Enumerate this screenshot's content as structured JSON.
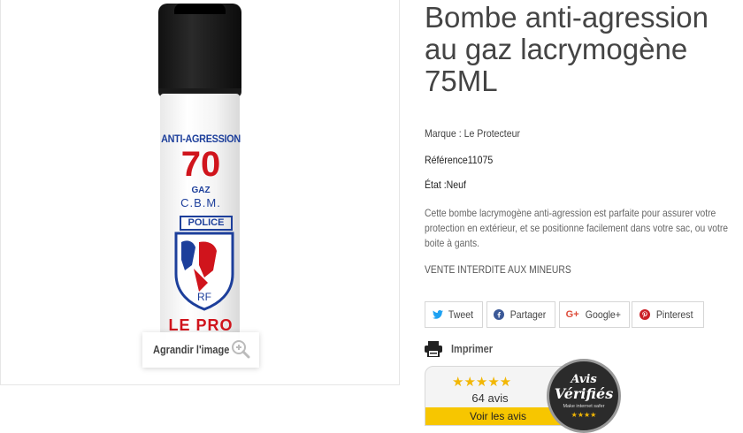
{
  "product": {
    "title": "Bombe anti-agression au gaz lacrymogène 75ML",
    "brand_line": "Marque : Le Protecteur",
    "reference_line": "Référence11075",
    "state_line": "État :Neuf",
    "description": "Cette bombe lacrymogène anti-agression est parfaite pour assurer votre protection en extérieur, et se positionne facilement dans votre sac, ou votre boite à gants.",
    "warning": "VENTE INTERDITE AUX MINEURS"
  },
  "image": {
    "zoom_label": "Agrandir l'image",
    "can_label": {
      "anti": "ANTI-AGRESSION",
      "number": "70",
      "gaz": "GAZ",
      "cbm": "C.B.M.",
      "police": "POLICE",
      "le_pro": "LE PRO"
    }
  },
  "share": {
    "tweet": "Tweet",
    "partager": "Partager",
    "google": "Google+",
    "pinterest": "Pinterest",
    "google_icon": "G+"
  },
  "print": {
    "label": "Imprimer"
  },
  "reviews": {
    "stars": "★★★★★",
    "rating": 5,
    "count_label": "64 avis",
    "link_label": "Voir les avis"
  },
  "badge": {
    "line1": "Avis",
    "line2": "Vérifiés",
    "sub": "Make internet safer",
    "stars": "★★★★"
  },
  "colors": {
    "accent_yellow": "#f7c600",
    "star_gold": "#f2b705",
    "label_blue": "#1d3f9b",
    "label_red": "#d0141c"
  }
}
